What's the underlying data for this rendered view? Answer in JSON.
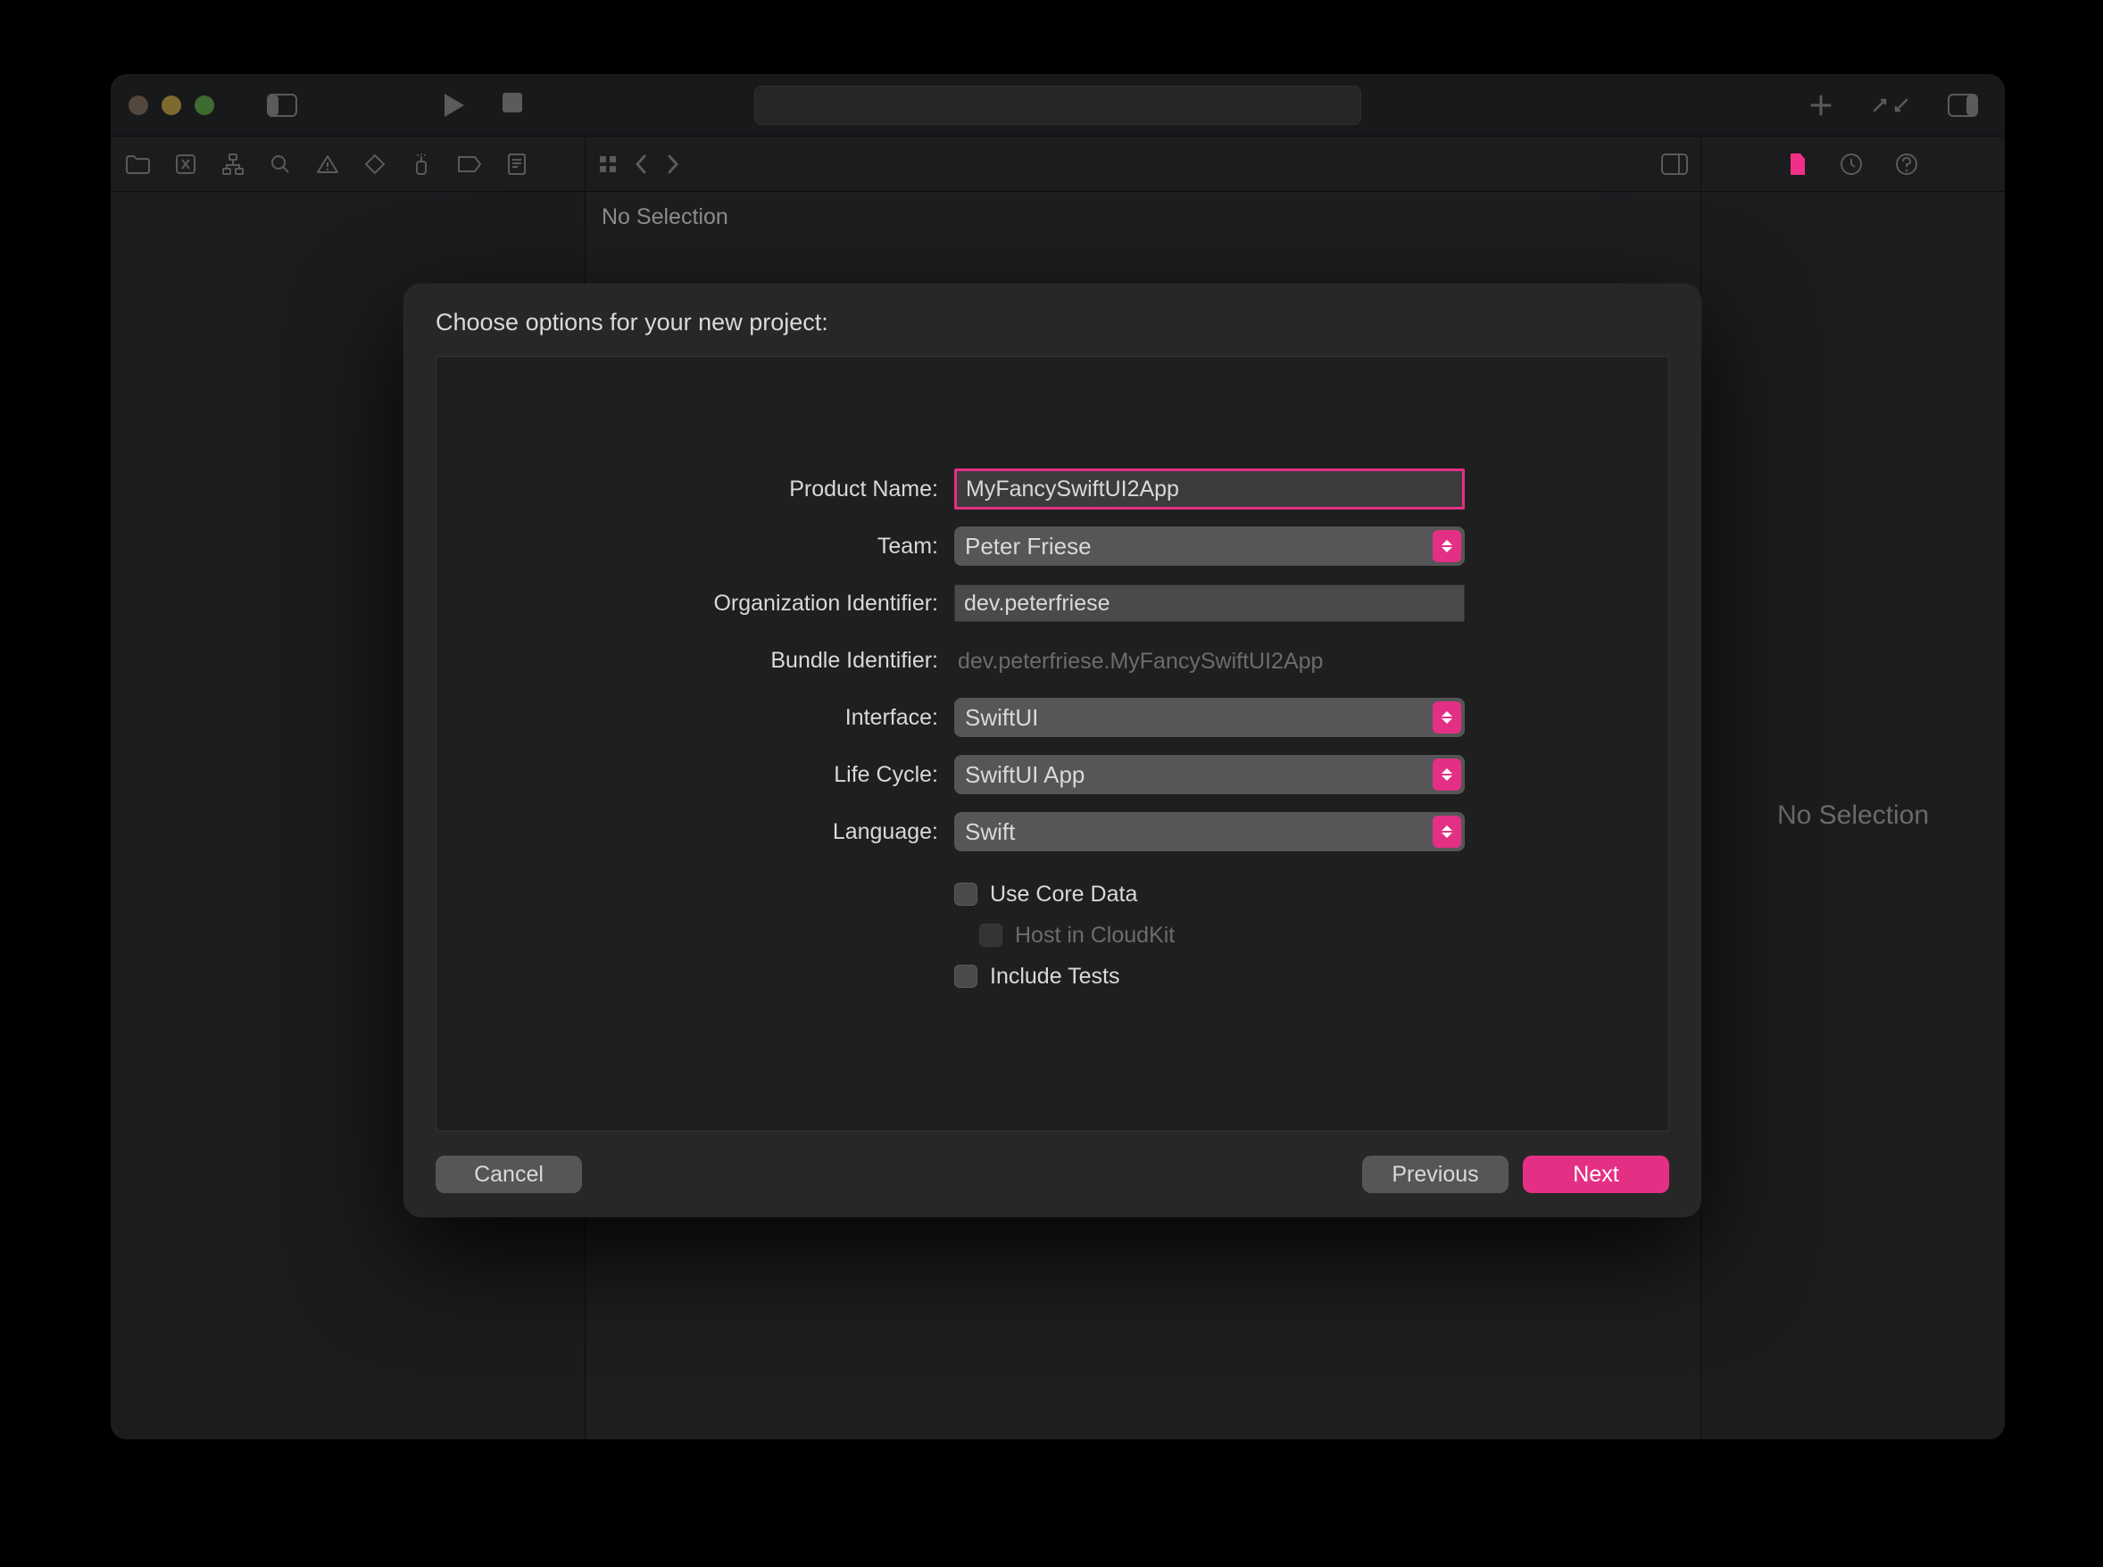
{
  "window": {
    "no_selection_editor": "No Selection",
    "no_selection_inspector": "No Selection"
  },
  "dialog": {
    "title": "Choose options for your new project:",
    "labels": {
      "product_name": "Product Name:",
      "team": "Team:",
      "org_id": "Organization Identifier:",
      "bundle_id": "Bundle Identifier:",
      "interface": "Interface:",
      "life_cycle": "Life Cycle:",
      "language": "Language:"
    },
    "values": {
      "product_name": "MyFancySwiftUI2App",
      "team": "Peter Friese",
      "org_id": "dev.peterfriese",
      "bundle_id": "dev.peterfriese.MyFancySwiftUI2App",
      "interface": "SwiftUI",
      "life_cycle": "SwiftUI App",
      "language": "Swift"
    },
    "checks": {
      "use_core_data": "Use Core Data",
      "host_cloudkit": "Host in CloudKit",
      "include_tests": "Include Tests"
    },
    "buttons": {
      "cancel": "Cancel",
      "previous": "Previous",
      "next": "Next"
    }
  }
}
